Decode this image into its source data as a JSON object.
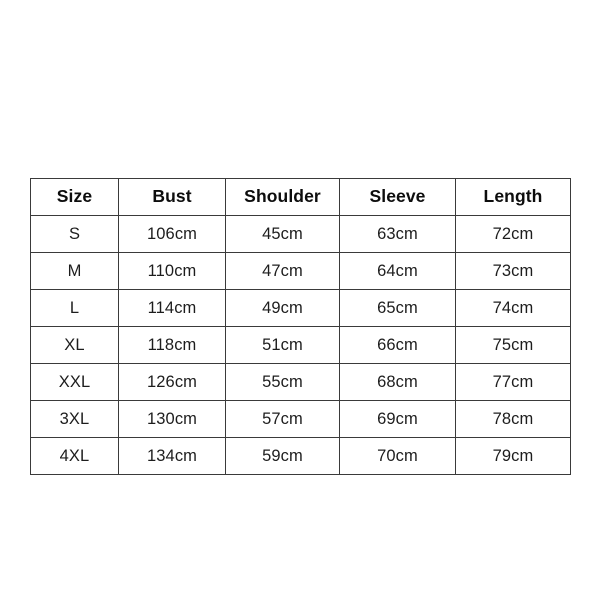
{
  "document": {
    "kind": "size-chart-table",
    "background_color": "#ffffff",
    "border_color": "#3a3a3a",
    "header_text_color": "#0d0d0d",
    "cell_text_color": "#1d1d1d"
  },
  "table": {
    "columns": [
      {
        "key": "size",
        "label": "Size"
      },
      {
        "key": "bust",
        "label": "Bust"
      },
      {
        "key": "shoulder",
        "label": "Shoulder"
      },
      {
        "key": "sleeve",
        "label": "Sleeve"
      },
      {
        "key": "length",
        "label": "Length"
      }
    ],
    "rows": [
      {
        "size": "S",
        "bust": "106cm",
        "shoulder": "45cm",
        "sleeve": "63cm",
        "length": "72cm"
      },
      {
        "size": "M",
        "bust": "110cm",
        "shoulder": "47cm",
        "sleeve": "64cm",
        "length": "73cm"
      },
      {
        "size": "L",
        "bust": "114cm",
        "shoulder": "49cm",
        "sleeve": "65cm",
        "length": "74cm"
      },
      {
        "size": "XL",
        "bust": "118cm",
        "shoulder": "51cm",
        "sleeve": "66cm",
        "length": "75cm"
      },
      {
        "size": "XXL",
        "bust": "126cm",
        "shoulder": "55cm",
        "sleeve": "68cm",
        "length": "77cm"
      },
      {
        "size": "3XL",
        "bust": "130cm",
        "shoulder": "57cm",
        "sleeve": "69cm",
        "length": "78cm"
      },
      {
        "size": "4XL",
        "bust": "134cm",
        "shoulder": "59cm",
        "sleeve": "70cm",
        "length": "79cm"
      }
    ]
  }
}
